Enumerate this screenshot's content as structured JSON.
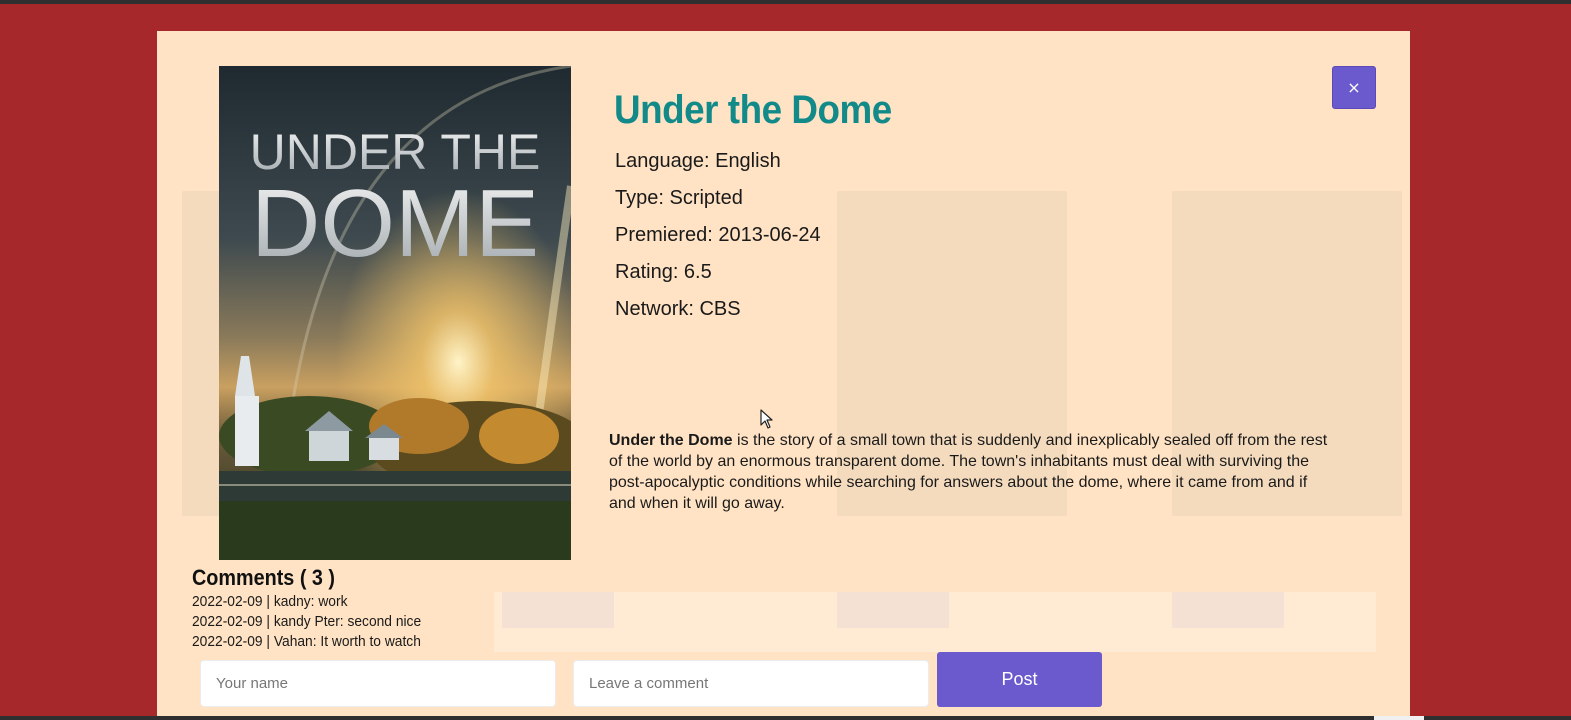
{
  "modal": {
    "close_label": "×",
    "title": "Under the Dome",
    "poster": {
      "title_line1": "UNDER THE",
      "title_line2": "DOME"
    },
    "info": [
      "Language: English",
      "Type: Scripted",
      "Premiered: 2013-06-24",
      "Rating: 6.5",
      "Network: CBS"
    ],
    "summary_bold": "Under the Dome",
    "summary_rest": " is the story of a small town that is suddenly and inexplicably sealed off from the rest of the world by an enormous transparent dome. The town's inhabitants must deal with surviving the post-apocalyptic conditions while searching for answers about the dome, where it came from and if and when it will go away.",
    "comments_title": "Comments ( 3 )",
    "comments": [
      "2022-02-09 | kadny: work",
      "2022-02-09 | kandy Pter: second nice",
      "2022-02-09 | Vahan: It worth to watch"
    ],
    "form": {
      "name_placeholder": "Your name",
      "comment_placeholder": "Leave a comment",
      "post_label": "Post"
    }
  },
  "colors": {
    "page_background": "#a6282a",
    "modal_background": "#ffe3c4",
    "accent": "#6a5acd",
    "title": "#128a89"
  },
  "icons": {
    "close": "close-icon",
    "cursor": "mouse-pointer-icon"
  }
}
